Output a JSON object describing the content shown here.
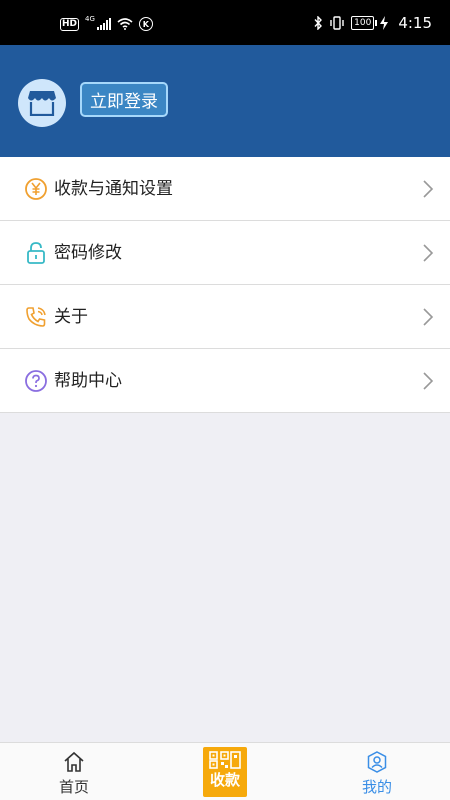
{
  "status_bar": {
    "hd": "HD",
    "network": "4G",
    "k": "K",
    "battery": "100",
    "time": "4:15"
  },
  "header": {
    "login_label": "立即登录"
  },
  "menu": [
    {
      "label": "收款与通知设置",
      "icon": "yuan-icon",
      "color": "#f0a030"
    },
    {
      "label": "密码修改",
      "icon": "lock-icon",
      "color": "#37b9c6"
    },
    {
      "label": "关于",
      "icon": "phone-icon",
      "color": "#f0a030"
    },
    {
      "label": "帮助中心",
      "icon": "question-icon",
      "color": "#8a6ee0"
    }
  ],
  "bottom_nav": {
    "home_label": "首页",
    "pay_label": "收款",
    "me_label": "我的",
    "active_color": "#3a8ee6",
    "pay_color": "#f6a90b"
  },
  "colors": {
    "header_bg": "#215a9c",
    "page_bg": "#efeff4"
  }
}
